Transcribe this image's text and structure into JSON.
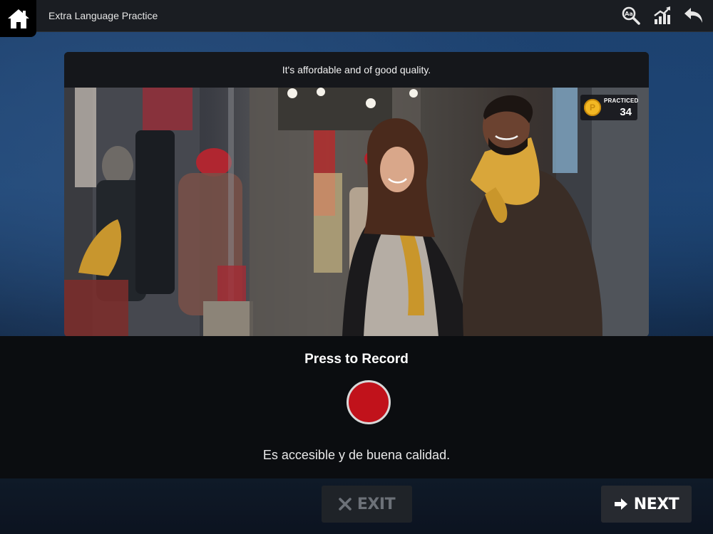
{
  "app": {
    "title": "Extra Language Practice"
  },
  "icons": {
    "home": "home-icon",
    "dictionary": "dictionary-search-icon",
    "progress": "progress-chart-icon",
    "back": "undo-arrow-icon"
  },
  "card": {
    "sentence": "It's affordable and of good quality.",
    "badge": {
      "label": "PRACTICED",
      "count": "34",
      "coin_letter": "P"
    }
  },
  "recorder": {
    "prompt": "Press to Record",
    "translation": "Es accesible y de buena calidad."
  },
  "buttons": {
    "exit_label": "EXIT",
    "next_label": "NEXT"
  },
  "colors": {
    "record_red": "#c1121b",
    "coin_gold": "#f2b824",
    "top_bar": "#1a1d22"
  }
}
